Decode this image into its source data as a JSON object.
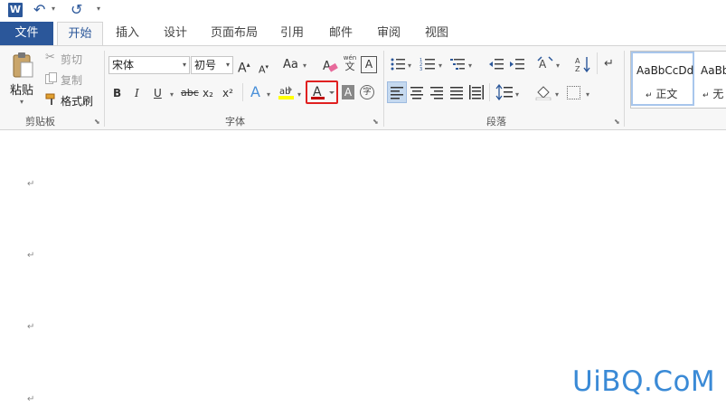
{
  "quick_access": {
    "app_icon": "W",
    "undo_icon": "↶",
    "redo_icon": "↺",
    "customize_icon": "▾"
  },
  "tabs": {
    "file": "文件",
    "home": "开始",
    "insert": "插入",
    "design": "设计",
    "layout": "页面布局",
    "references": "引用",
    "mailings": "邮件",
    "review": "审阅",
    "view": "视图"
  },
  "clipboard": {
    "paste": "粘贴",
    "cut": "剪切",
    "copy": "复制",
    "format_painter": "格式刷",
    "group_label": "剪贴板"
  },
  "font": {
    "font_name": "宋体",
    "font_size": "初号",
    "change_case": "Aa",
    "bold": "B",
    "italic": "I",
    "underline": "U",
    "strikethrough": "abc",
    "subscript": "x₂",
    "superscript": "x²",
    "group_label": "字体",
    "phonetic_top": "wén",
    "phonetic_bottom": "文",
    "enclose_char": "字",
    "font_color_highlighted": true,
    "font_color": "#c00000",
    "highlight_color": "#ffff00"
  },
  "paragraph": {
    "group_label": "段落"
  },
  "styles": {
    "style1_preview": "AaBbCcDd",
    "style1_name": "正文",
    "style2_preview": "AaBb",
    "style2_name": "无"
  },
  "document": {
    "paragraph_mark": "↵"
  },
  "watermark": "UiBQ.CoM",
  "colors": {
    "accent": "#2b579a",
    "highlight_box": "#e02020"
  }
}
